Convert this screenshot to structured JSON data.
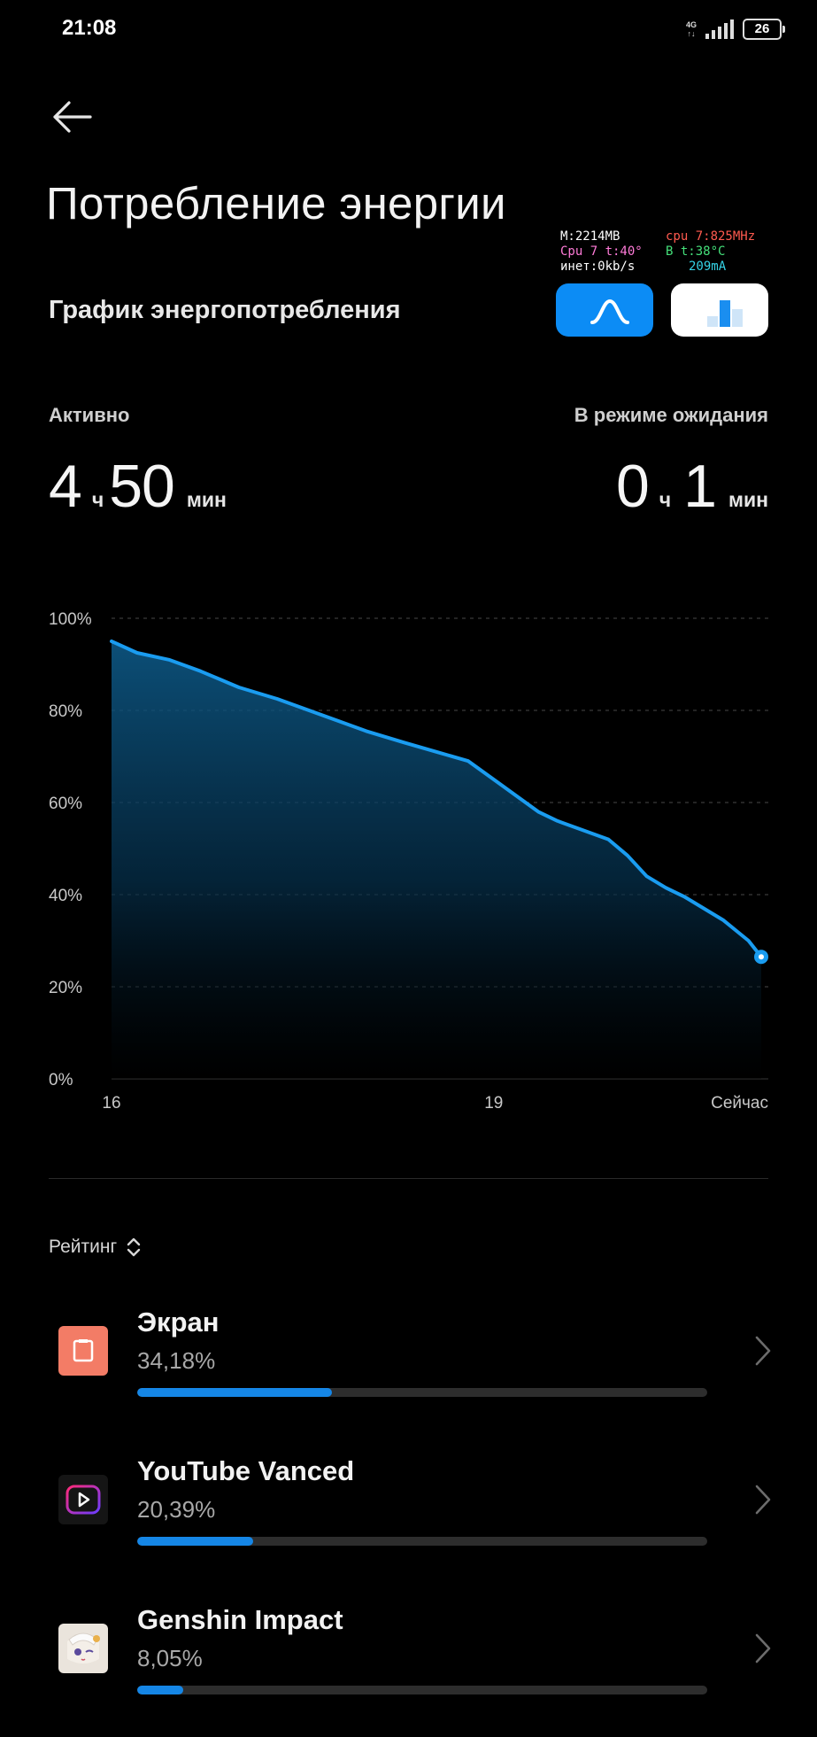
{
  "status_bar": {
    "time": "21:08",
    "network": "4G",
    "battery": "26"
  },
  "page": {
    "title": "Потребление энергии"
  },
  "monitor": {
    "mem": "M:2214MB",
    "cpu_freq": "cpu 7:825MHz",
    "cpu_temp": "Cpu 7 t:40°",
    "batt_temp": "B t:38°C",
    "net": "инет:0kb/s",
    "current": "209mA"
  },
  "graph_section": {
    "title": "График энергопотребления"
  },
  "usage": {
    "active_label": "Активно",
    "active_hours": "4",
    "active_minutes": "50",
    "standby_label": "В режиме ожидания",
    "standby_hours": "0",
    "standby_minutes": "1",
    "hours_unit": "ч",
    "minutes_unit": "мин"
  },
  "chart_data": {
    "type": "area",
    "y_ticks": [
      "100%",
      "80%",
      "60%",
      "40%",
      "20%",
      "0%"
    ],
    "x_tick_labels": [
      "16",
      "19",
      "Сейчас"
    ],
    "x_tick_positions": [
      16,
      19,
      21.1
    ],
    "ylim": [
      0,
      100
    ],
    "xlim": [
      16,
      21.1
    ],
    "grid": true,
    "x": [
      16.0,
      16.2,
      16.45,
      16.7,
      17.0,
      17.3,
      17.55,
      17.8,
      18.0,
      18.3,
      18.55,
      18.8,
      19.0,
      19.15,
      19.35,
      19.5,
      19.65,
      19.9,
      20.05,
      20.2,
      20.35,
      20.5,
      20.65,
      20.8,
      21.0,
      21.1
    ],
    "y": [
      95,
      92.5,
      91,
      88.5,
      85,
      82.5,
      80,
      77.5,
      75.5,
      73,
      71,
      69,
      65,
      62,
      58,
      56,
      54.5,
      52,
      48.5,
      44,
      41.5,
      39.5,
      37,
      34.5,
      30,
      26.5
    ],
    "color": "#1a9cf0"
  },
  "sort": {
    "label": "Рейтинг"
  },
  "apps": [
    {
      "name": "Экран",
      "percent_label": "34,18%",
      "percent": 34.18,
      "icon": "screen-icon"
    },
    {
      "name": "YouTube Vanced",
      "percent_label": "20,39%",
      "percent": 20.39,
      "icon": "youtube-vanced-icon"
    },
    {
      "name": "Genshin Impact",
      "percent_label": "8,05%",
      "percent": 8.05,
      "icon": "genshin-impact-icon"
    }
  ]
}
